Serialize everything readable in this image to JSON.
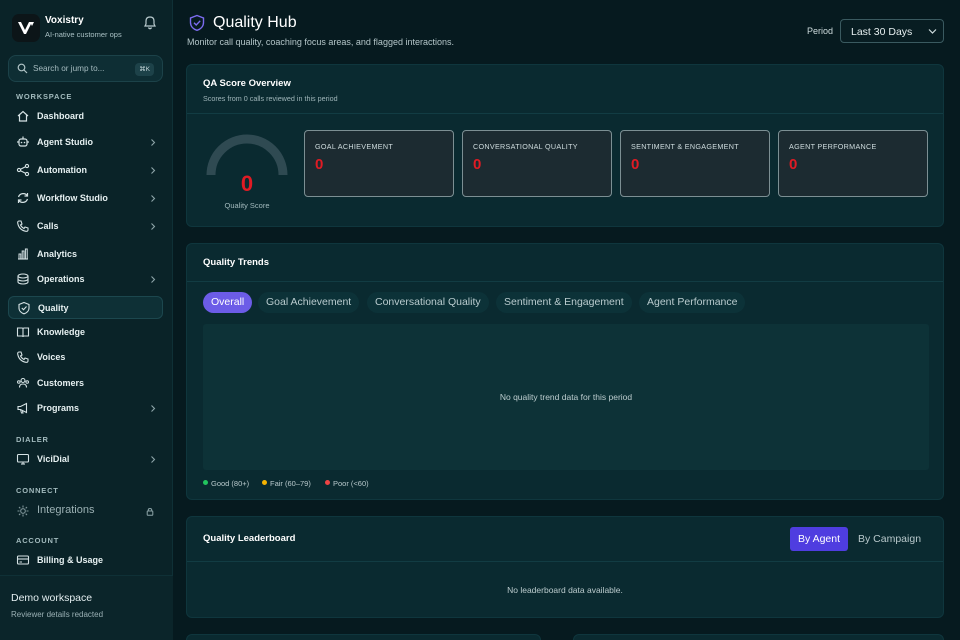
{
  "app": {
    "name": "Voxistry",
    "tagline": "AI-native customer ops"
  },
  "search": {
    "placeholder": "Search or jump to...",
    "shortcut": "⌘K"
  },
  "sidebar": {
    "sections": {
      "workspace": "WORKSPACE",
      "dialer": "DIALER",
      "connect": "CONNECT",
      "account": "ACCOUNT"
    },
    "items": [
      {
        "label": "Dashboard",
        "icon": "home-icon"
      },
      {
        "label": "Agent Studio",
        "icon": "agent-icon"
      },
      {
        "label": "Automation",
        "icon": "share-icon"
      },
      {
        "label": "Workflow Studio",
        "icon": "refresh-icon"
      },
      {
        "label": "Calls",
        "icon": "phone-icon"
      },
      {
        "label": "Analytics",
        "icon": "bar-chart-icon"
      },
      {
        "label": "Operations",
        "icon": "layers-icon"
      },
      {
        "label": "Quality",
        "icon": "shield-check-icon"
      },
      {
        "label": "Knowledge",
        "icon": "book-icon"
      },
      {
        "label": "Voices",
        "icon": "phone-icon"
      },
      {
        "label": "Customers",
        "icon": "users-icon"
      },
      {
        "label": "Programs",
        "icon": "megaphone-icon"
      },
      {
        "label": "ViciDial",
        "icon": "monitor-icon"
      },
      {
        "label": "Integrations",
        "icon": "puzzle-icon"
      },
      {
        "label": "Billing & Usage",
        "icon": "credit-card-icon"
      }
    ],
    "workspace_name": "Demo workspace",
    "workspace_sub": "Reviewer details redacted"
  },
  "header": {
    "title": "Quality Hub",
    "subtitle": "Monitor call quality, coaching focus areas, and flagged interactions.",
    "period_label": "Period",
    "period_value": "Last 30 Days"
  },
  "overview": {
    "title": "QA Score Overview",
    "subtitle": "Scores from 0 calls reviewed in this period",
    "score": "0",
    "score_label": "Quality Score",
    "score_fraction": 0,
    "metrics": [
      {
        "label": "GOAL ACHIEVEMENT",
        "value": "0"
      },
      {
        "label": "CONVERSATIONAL QUALITY",
        "value": "0"
      },
      {
        "label": "SENTIMENT & ENGAGEMENT",
        "value": "0"
      },
      {
        "label": "AGENT PERFORMANCE",
        "value": "0"
      }
    ]
  },
  "trends": {
    "title": "Quality Trends",
    "tabs": [
      "Overall",
      "Goal Achievement",
      "Conversational Quality",
      "Sentiment & Engagement",
      "Agent Performance"
    ],
    "empty": "No quality trend data for this period",
    "legend": [
      {
        "label": "Good (80+)",
        "color": "#22c55e"
      },
      {
        "label": "Fair (60–79)",
        "color": "#f5b301"
      },
      {
        "label": "Poor (<60)",
        "color": "#ef4444"
      }
    ]
  },
  "leaderboard": {
    "title": "Quality Leaderboard",
    "by_agent": "By Agent",
    "by_campaign": "By Campaign",
    "empty": "No leaderboard data available."
  },
  "colors": {
    "accent": "#6c5ce7",
    "danger": "#e01b24",
    "background": "#061a1f"
  }
}
